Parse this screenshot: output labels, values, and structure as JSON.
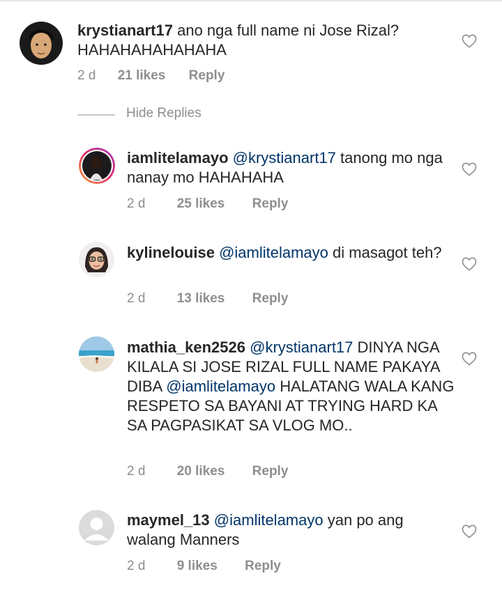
{
  "comments": [
    {
      "username": "krystianart17",
      "mention": "",
      "text": "ano nga full name ni Jose Rizal? HAHAHAHAHAHAHA",
      "time": "2 d",
      "likes": "21 likes",
      "reply": "Reply"
    },
    {
      "username": "iamlitelamayo",
      "mention": "@krystianart17",
      "text": "tanong mo nga nanay mo HAHAHAHA",
      "time": "2 d",
      "likes": "25 likes",
      "reply": "Reply"
    },
    {
      "username": "kylinelouise",
      "mention": "@iamlitelamayo",
      "text": "di masagot teh?",
      "time": "2 d",
      "likes": "13 likes",
      "reply": "Reply"
    },
    {
      "username": "mathia_ken2526",
      "mention": "@krystianart17",
      "text_before": "DINYA NGA KILALA SI JOSE RIZAL FULL NAME PAKAYA DIBA",
      "mention2": "@iamlitelamayo",
      "text_after": "HALATANG WALA KANG RESPETO SA BAYANI AT TRYING HARD KA SA PAGPASIKAT  SA VLOG MO..",
      "time": "2 d",
      "likes": "20 likes",
      "reply": "Reply"
    },
    {
      "username": "maymel_13",
      "mention": "@iamlitelamayo",
      "text": "yan po ang walang Manners",
      "time": "2 d",
      "likes": "9 likes",
      "reply": "Reply"
    }
  ],
  "hide_replies_label": "Hide Replies",
  "colors": {
    "text": "#262626",
    "mention": "#003569",
    "meta": "#8e8e8e"
  }
}
